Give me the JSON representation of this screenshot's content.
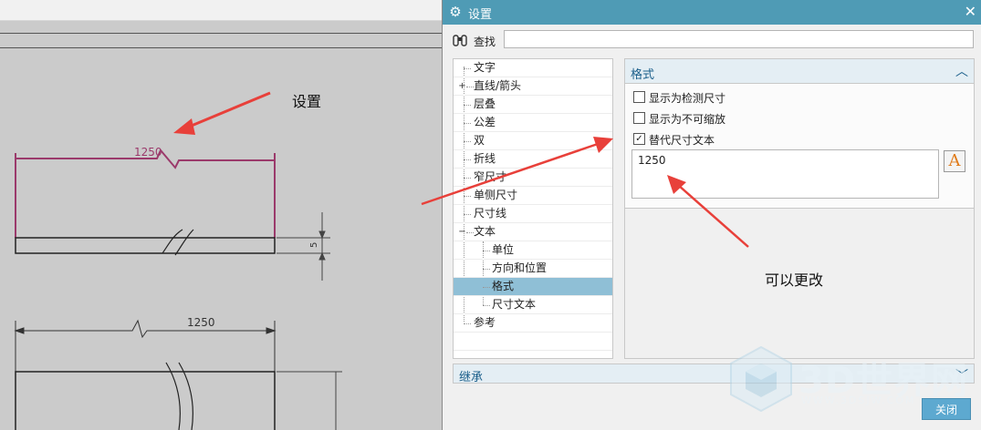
{
  "cad": {
    "dim_top": "1250",
    "dim_bottom": "1250",
    "dim_side": "5"
  },
  "annotations": {
    "setting_note": "设置",
    "modify_note": "可以更改"
  },
  "dialog": {
    "title": "设置",
    "search": {
      "label": "查找",
      "value": "",
      "placeholder": ""
    },
    "tree": [
      {
        "label": "文字",
        "level": 0
      },
      {
        "label": "直线/箭头",
        "level": 0,
        "expander": "+"
      },
      {
        "label": "层叠",
        "level": 0
      },
      {
        "label": "公差",
        "level": 0
      },
      {
        "label": "双",
        "level": 0
      },
      {
        "label": "折线",
        "level": 0
      },
      {
        "label": "窄尺寸",
        "level": 0
      },
      {
        "label": "单侧尺寸",
        "level": 0
      },
      {
        "label": "尺寸线",
        "level": 0
      },
      {
        "label": "文本",
        "level": 0,
        "expander": "−"
      },
      {
        "label": "单位",
        "level": 1
      },
      {
        "label": "方向和位置",
        "level": 1
      },
      {
        "label": "格式",
        "level": 1,
        "selected": true
      },
      {
        "label": "尺寸文本",
        "level": 1
      },
      {
        "label": "参考",
        "level": 0
      }
    ],
    "format_panel": {
      "title": "格式",
      "checkboxes": [
        {
          "label": "显示为检测尺寸",
          "checked": false
        },
        {
          "label": "显示为不可缩放",
          "checked": false
        },
        {
          "label": "替代尺寸文本",
          "checked": true
        }
      ],
      "alt_text_value": "1250",
      "font_button": "A"
    },
    "inherit_label": "继承",
    "close_label": "关闭"
  },
  "watermark": {
    "brand": "3D世界网",
    "url": "WWW.3DSJW.COM"
  },
  "colors": {
    "titlebar": "#4f9bb5",
    "selected": "#8fbfd6",
    "panel_title": "#1a5e8a",
    "arrow": "#e8403a",
    "dim_magenta": "#9b3a6b"
  }
}
